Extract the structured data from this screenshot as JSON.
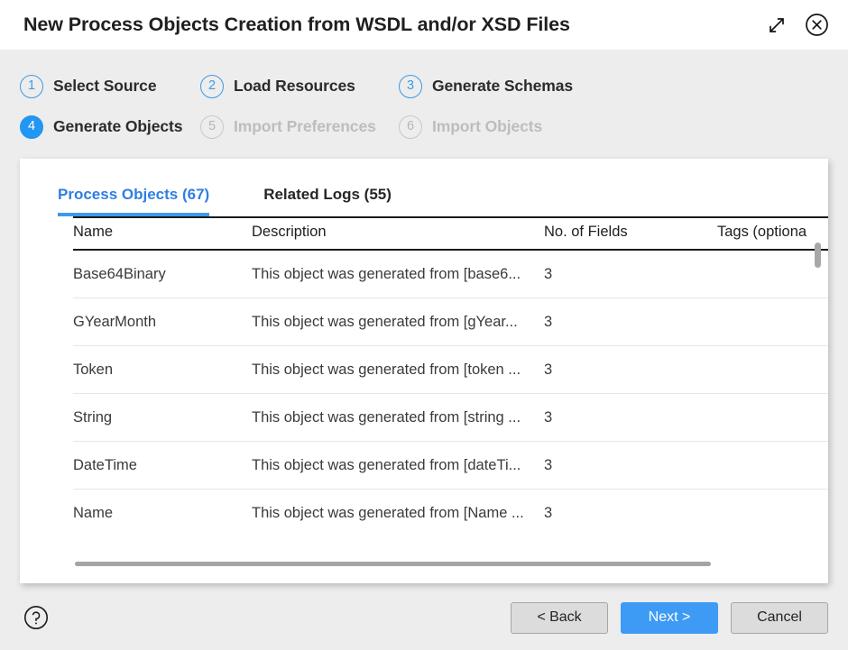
{
  "window": {
    "title": "New Process Objects Creation from WSDL and/or XSD Files",
    "expand_icon": "expand-diagonal-icon",
    "close_icon": "close-circle-icon"
  },
  "wizard": {
    "steps": [
      {
        "number": "1",
        "label": "Select Source",
        "state": "done"
      },
      {
        "number": "2",
        "label": "Load Resources",
        "state": "done"
      },
      {
        "number": "3",
        "label": "Generate Schemas",
        "state": "done"
      },
      {
        "number": "4",
        "label": "Generate Objects",
        "state": "current"
      },
      {
        "number": "5",
        "label": "Import Preferences",
        "state": "disabled"
      },
      {
        "number": "6",
        "label": "Import Objects",
        "state": "disabled"
      }
    ]
  },
  "tabs": [
    {
      "label": "Process Objects (67)",
      "active": true
    },
    {
      "label": "Related Logs (55)",
      "active": false
    }
  ],
  "table": {
    "columns": [
      "Name",
      "Description",
      "No. of Fields",
      "Tags (optiona"
    ],
    "rows": [
      {
        "name": "Base64Binary",
        "description": "This object was generated from [base6...",
        "fields": "3",
        "tags": ""
      },
      {
        "name": "GYearMonth",
        "description": "This object was generated from [gYear...",
        "fields": "3",
        "tags": ""
      },
      {
        "name": "Token",
        "description": "This object was generated from [token ...",
        "fields": "3",
        "tags": ""
      },
      {
        "name": "String",
        "description": "This object was generated from [string ...",
        "fields": "3",
        "tags": ""
      },
      {
        "name": "DateTime",
        "description": "This object was generated from [dateTi...",
        "fields": "3",
        "tags": ""
      },
      {
        "name": "Name",
        "description": "This object was generated from [Name ...",
        "fields": "3",
        "tags": ""
      }
    ]
  },
  "footer": {
    "help_icon": "help-circle-icon",
    "back_label": "< Back",
    "next_label": "Next >",
    "cancel_label": "Cancel"
  },
  "colors": {
    "accent_blue": "#3d9bf5",
    "step_current": "#2196f3",
    "tab_active": "#2f7fe0",
    "background": "#ededed",
    "card": "#ffffff"
  }
}
